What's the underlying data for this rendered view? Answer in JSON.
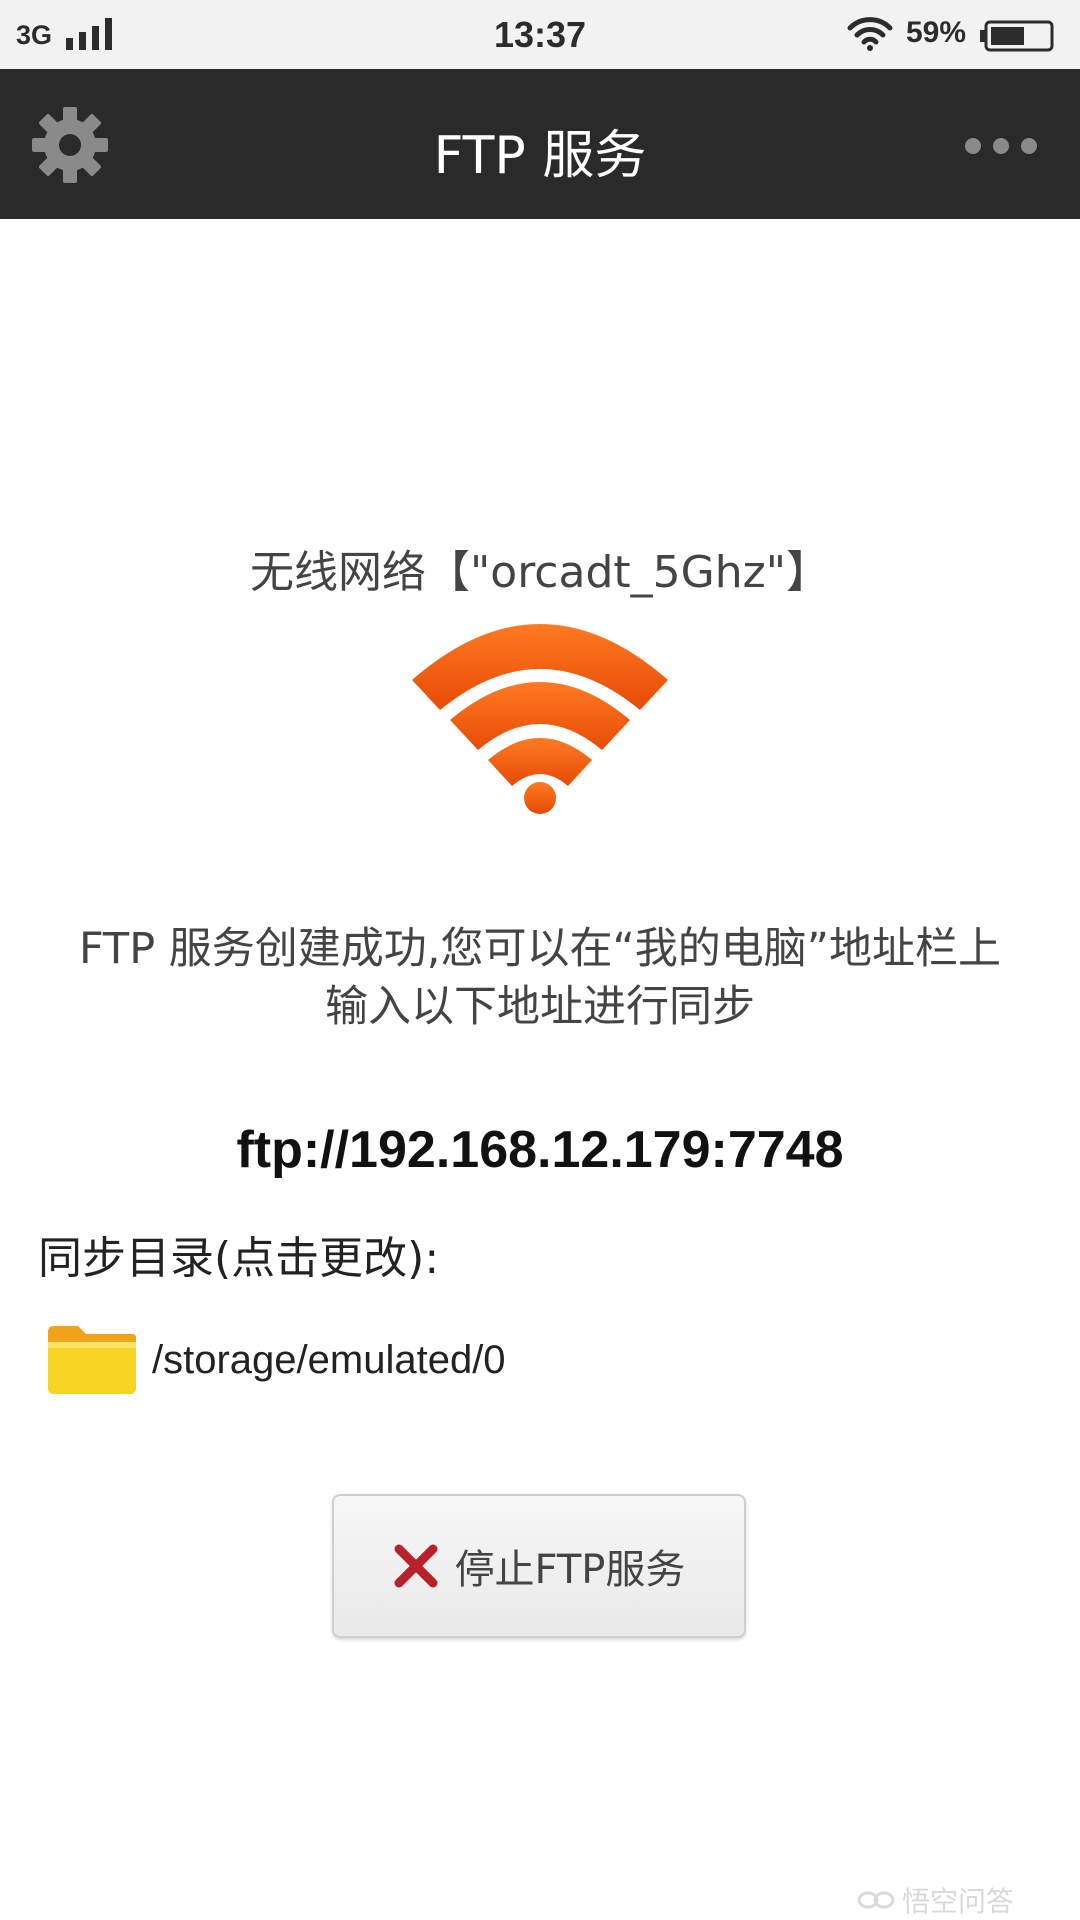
{
  "status_bar": {
    "network": "3G",
    "time": "13:37",
    "battery_percent": "59%",
    "battery_level": 0.59,
    "icons": [
      "signal-icon",
      "wifi-icon",
      "battery-icon"
    ]
  },
  "app_bar": {
    "title": "FTP 服务",
    "left_icon": "gear-icon",
    "right_icon": "more-icon"
  },
  "content": {
    "network_label": "无线网络【\"orcadt_5Ghz\"】",
    "message_line1": "FTP 服务创建成功,您可以在“我的电脑”地址栏上",
    "message_line2": "输入以下地址进行同步",
    "ftp_address": "ftp://192.168.12.179:7748",
    "sync_label": "同步目录(点击更改):",
    "sync_path": "/storage/emulated/0",
    "stop_button_label": "停止FTP服务"
  },
  "watermark": {
    "text": "悟空问答"
  },
  "colors": {
    "app_bar": "#2a2a2a",
    "wifi_orange": "#f05a10",
    "folder_yellow": "#f7d323",
    "stop_red": "#b8202a"
  }
}
